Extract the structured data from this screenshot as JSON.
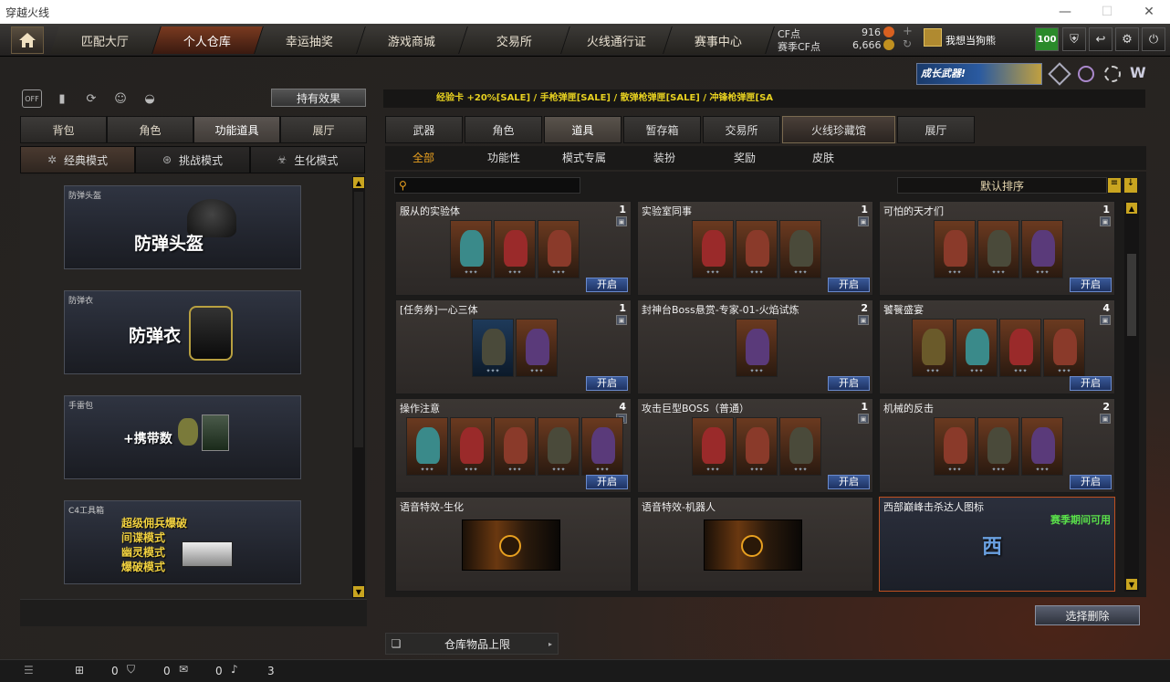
{
  "window": {
    "title": "穿越火线",
    "controls": [
      "—",
      "☐",
      "✕"
    ]
  },
  "topnav": {
    "tabs": [
      "匹配大厅",
      "个人仓库",
      "幸运抽奖",
      "游戏商城",
      "交易所",
      "火线通行证",
      "赛事中心"
    ],
    "active": 1,
    "cf_label": "CF点",
    "cf_value": "916",
    "cf2_label": "赛季CF点",
    "cf2_value": "6,666",
    "username": "我想当狗熊",
    "level_badge": "100"
  },
  "banner": {
    "text": "成长武器!"
  },
  "left": {
    "effects_button": "持有效果",
    "tabs": [
      "背包",
      "角色",
      "功能道具",
      "展厅"
    ],
    "active_tab": 2,
    "modes": [
      "经典模式",
      "挑战模式",
      "生化模式"
    ],
    "active_mode": 0,
    "cards": [
      {
        "caption": "防弹头盔",
        "big": "防弹头盔"
      },
      {
        "caption": "防弹衣",
        "big": "防弹衣"
      },
      {
        "caption": "手雷包",
        "big": "+携带数"
      },
      {
        "caption": "C4工具箱",
        "lines": [
          "超级佣兵爆破",
          "间谍模式",
          "幽灵模式",
          "爆破模式"
        ]
      }
    ]
  },
  "right": {
    "ticker": "经验卡 +20%[SALE] / 手枪弹匣[SALE] / 散弹枪弹匣[SALE] / 冲锋枪弹匣[SA",
    "tabs": [
      "武器",
      "角色",
      "道具",
      "暂存箱",
      "交易所",
      "火线珍藏馆",
      "展厅"
    ],
    "active_tab": 2,
    "subtabs": [
      "全部",
      "功能性",
      "模式专属",
      "装扮",
      "奖励",
      "皮肤"
    ],
    "active_subtab": 0,
    "search_placeholder": "",
    "sort_label": "默认排序",
    "open_label": "开启",
    "items": [
      {
        "name": "服从的实验体",
        "count": "1",
        "mons": 3
      },
      {
        "name": "实验室同事",
        "count": "1",
        "mons": 3
      },
      {
        "name": "可怕的天才们",
        "count": "1",
        "mons": 3
      },
      {
        "name": "[任务券]一心三体",
        "count": "1",
        "mons": 2
      },
      {
        "name": "封神台Boss悬赏-专家-01-火焰试炼",
        "count": "2",
        "mons": 1
      },
      {
        "name": "饕餮盛宴",
        "count": "4",
        "mons": 4
      },
      {
        "name": "操作注意",
        "count": "4",
        "mons": 5
      },
      {
        "name": "攻击巨型BOSS（普通）",
        "count": "1",
        "mons": 3
      },
      {
        "name": "机械的反击",
        "count": "2",
        "mons": 3
      },
      {
        "name": "语音特效-生化"
      },
      {
        "name": "语音特效-机器人"
      },
      {
        "name": "西部巅峰击杀达人图标",
        "note": "赛季期间可用",
        "glyph": "西"
      }
    ],
    "delete_button": "选择删除",
    "warehouse_limit": "仓库物品上限"
  },
  "status": {
    "values": [
      "0",
      "0",
      "0",
      "3"
    ]
  },
  "colors": {
    "accent": "#e8a020",
    "open_btn": "#2a4a8a",
    "ticker": "#e6d020"
  }
}
